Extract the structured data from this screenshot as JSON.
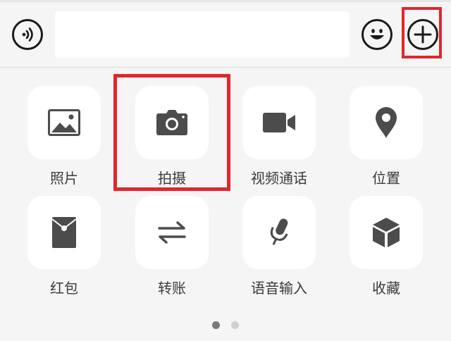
{
  "input_bar": {
    "voice_icon": "voice-wave-icon",
    "text_value": "",
    "emoji_icon": "smiley-icon",
    "plus_icon": "plus-circle-icon"
  },
  "panel": {
    "items": [
      {
        "label": "照片",
        "icon": "photo-icon"
      },
      {
        "label": "拍摄",
        "icon": "camera-icon"
      },
      {
        "label": "视频通话",
        "icon": "video-call-icon"
      },
      {
        "label": "位置",
        "icon": "location-pin-icon"
      },
      {
        "label": "红包",
        "icon": "red-packet-icon"
      },
      {
        "label": "转账",
        "icon": "transfer-arrows-icon"
      },
      {
        "label": "语音输入",
        "icon": "microphone-icon"
      },
      {
        "label": "收藏",
        "icon": "favorites-cube-icon"
      }
    ]
  },
  "pagination": {
    "pages": 2,
    "current": 1
  },
  "colors": {
    "icon": "#4c4c4c",
    "highlight": "#e2262a",
    "dot_active": "#7a7a7a",
    "dot_inactive": "#d0d0d0"
  }
}
